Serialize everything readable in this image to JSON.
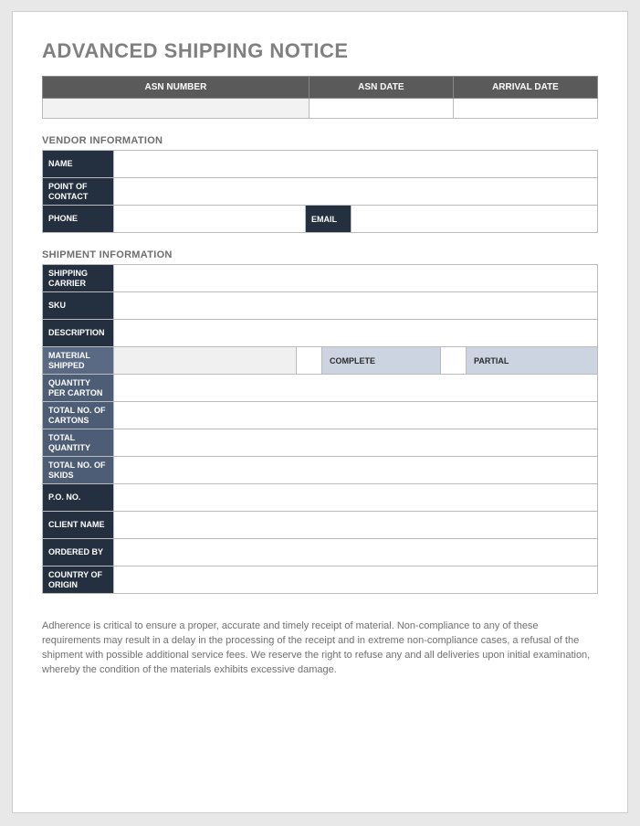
{
  "title": "ADVANCED SHIPPING NOTICE",
  "asn_header": {
    "col_number": "ASN NUMBER",
    "col_date": "ASN DATE",
    "col_arrival": "ARRIVAL DATE"
  },
  "vendor": {
    "section_label": "VENDOR INFORMATION",
    "name_label": "NAME",
    "poc_label": "POINT OF CONTACT",
    "phone_label": "PHONE",
    "email_label": "EMAIL"
  },
  "shipment": {
    "section_label": "SHIPMENT INFORMATION",
    "carrier_label": "SHIPPING CARRIER",
    "sku_label": "SKU",
    "description_label": "DESCRIPTION",
    "material_label": "MATERIAL SHIPPED",
    "complete_label": "COMPLETE",
    "partial_label": "PARTIAL",
    "qty_carton_label": "QUANTITY PER CARTON",
    "total_cartons_label": "TOTAL NO. OF CARTONS",
    "total_qty_label": "TOTAL QUANTITY",
    "total_skids_label": "TOTAL NO. OF SKIDS",
    "po_label": "P.O. NO.",
    "client_label": "CLIENT NAME",
    "ordered_by_label": "ORDERED BY",
    "origin_label": "COUNTRY OF ORIGIN"
  },
  "disclaimer": "Adherence is critical to ensure a proper, accurate and timely receipt of material. Non-compliance to any of these requirements may result in a delay in the processing of the receipt and in extreme non-compliance cases, a refusal of the shipment with possible additional service fees. We reserve the right to refuse any and all deliveries upon initial examination, whereby the condition of the materials exhibits excessive damage."
}
